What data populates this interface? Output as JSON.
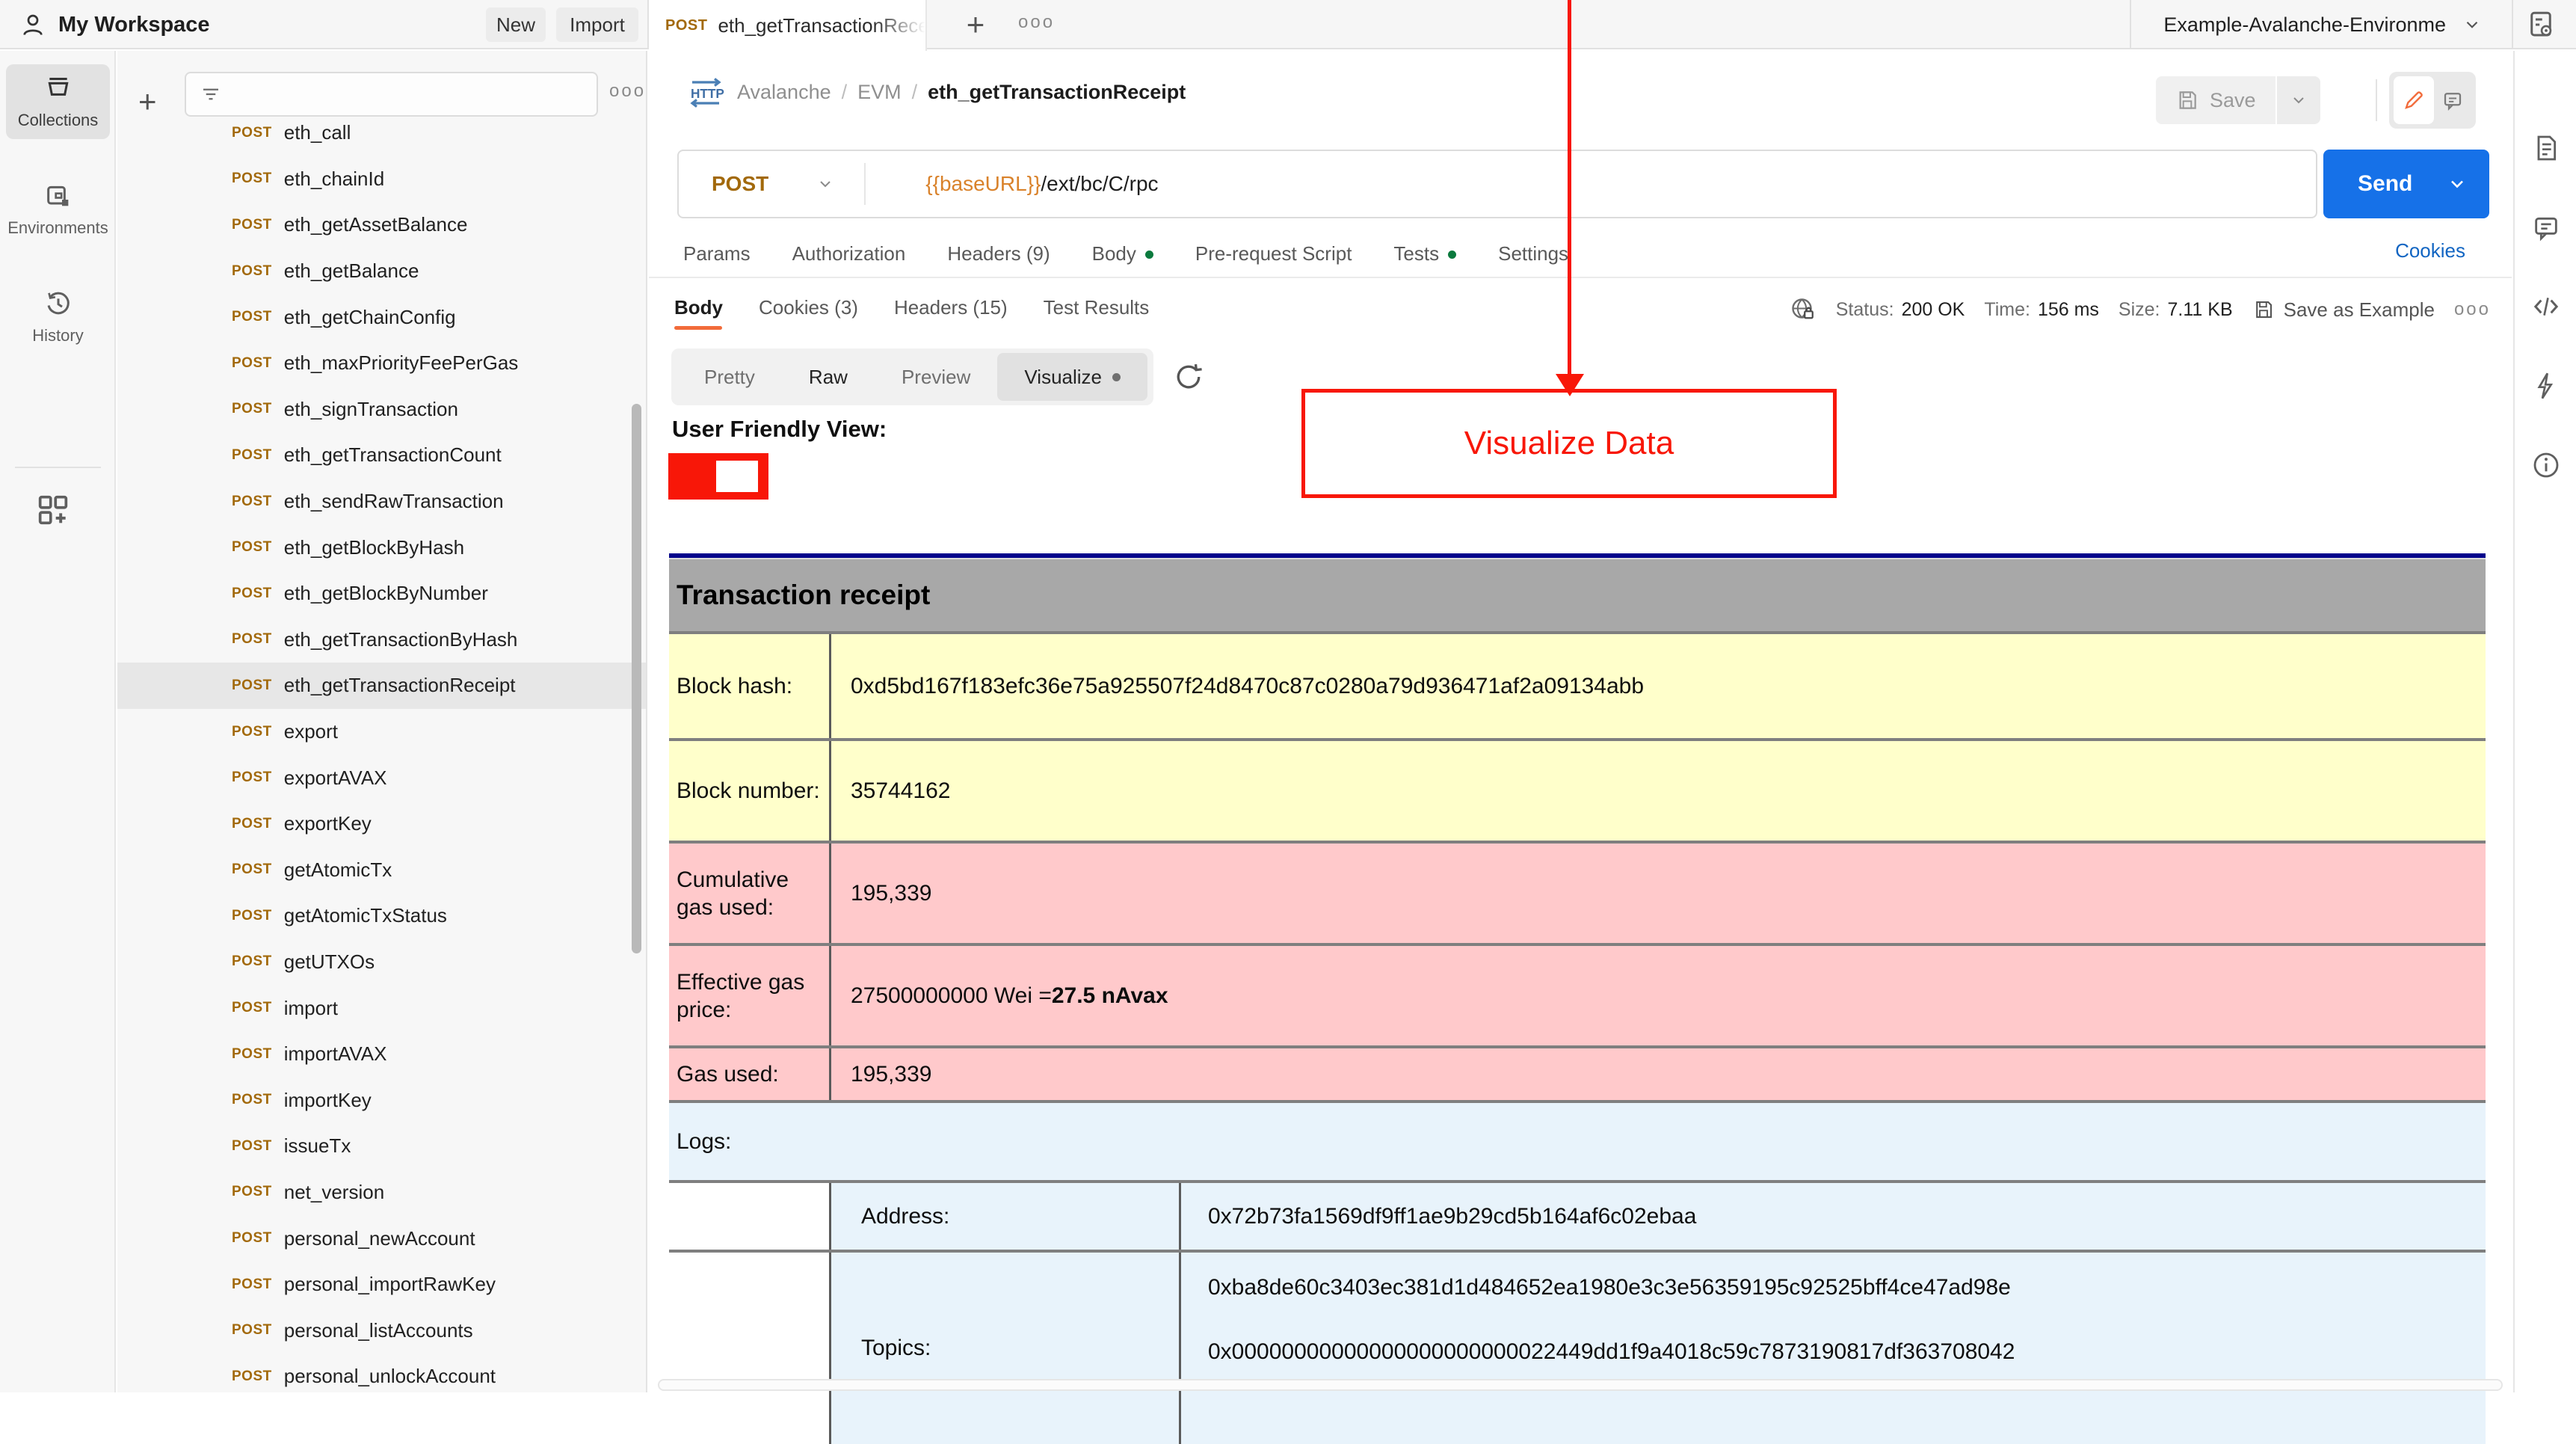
{
  "topbar": {
    "workspace": "My Workspace",
    "new_label": "New",
    "import_label": "Import",
    "tab": {
      "method": "POST",
      "label": "eth_getTransactionRece"
    },
    "environment": "Example-Avalanche-Environme"
  },
  "rail": {
    "items": [
      {
        "label": "Collections"
      },
      {
        "label": "Environments"
      },
      {
        "label": "History"
      }
    ]
  },
  "sidebar": {
    "items": [
      {
        "method": "POST",
        "name": "eth_call"
      },
      {
        "method": "POST",
        "name": "eth_chainId"
      },
      {
        "method": "POST",
        "name": "eth_getAssetBalance"
      },
      {
        "method": "POST",
        "name": "eth_getBalance"
      },
      {
        "method": "POST",
        "name": "eth_getChainConfig"
      },
      {
        "method": "POST",
        "name": "eth_maxPriorityFeePerGas"
      },
      {
        "method": "POST",
        "name": "eth_signTransaction"
      },
      {
        "method": "POST",
        "name": "eth_getTransactionCount"
      },
      {
        "method": "POST",
        "name": "eth_sendRawTransaction"
      },
      {
        "method": "POST",
        "name": "eth_getBlockByHash"
      },
      {
        "method": "POST",
        "name": "eth_getBlockByNumber"
      },
      {
        "method": "POST",
        "name": "eth_getTransactionByHash"
      },
      {
        "method": "POST",
        "name": "eth_getTransactionReceipt",
        "classes": [
          "selected"
        ]
      },
      {
        "method": "POST",
        "name": "export"
      },
      {
        "method": "POST",
        "name": "exportAVAX"
      },
      {
        "method": "POST",
        "name": "exportKey"
      },
      {
        "method": "POST",
        "name": "getAtomicTx"
      },
      {
        "method": "POST",
        "name": "getAtomicTxStatus"
      },
      {
        "method": "POST",
        "name": "getUTXOs"
      },
      {
        "method": "POST",
        "name": "import"
      },
      {
        "method": "POST",
        "name": "importAVAX"
      },
      {
        "method": "POST",
        "name": "importKey"
      },
      {
        "method": "POST",
        "name": "issueTx"
      },
      {
        "method": "POST",
        "name": "net_version"
      },
      {
        "method": "POST",
        "name": "personal_newAccount"
      },
      {
        "method": "POST",
        "name": "personal_importRawKey"
      },
      {
        "method": "POST",
        "name": "personal_listAccounts"
      },
      {
        "method": "POST",
        "name": "personal_unlockAccount"
      }
    ]
  },
  "request": {
    "breadcrumb": [
      "Avalanche",
      "EVM",
      "eth_getTransactionReceipt"
    ],
    "save_label": "Save",
    "method": "POST",
    "url_var": "{{baseURL}}",
    "url_path": "/ext/bc/C/rpc",
    "send_label": "Send",
    "tabs": [
      {
        "label": "Params"
      },
      {
        "label": "Authorization"
      },
      {
        "label": "Headers (9)"
      },
      {
        "label": "Body",
        "classes": [
          "dot"
        ]
      },
      {
        "label": "Pre-request Script"
      },
      {
        "label": "Tests",
        "classes": [
          "dot"
        ]
      },
      {
        "label": "Settings"
      }
    ],
    "cookies_link": "Cookies"
  },
  "response": {
    "tabs": [
      {
        "label": "Body",
        "classes": [
          "active"
        ]
      },
      {
        "label": "Cookies (3)"
      },
      {
        "label": "Headers (15)"
      },
      {
        "label": "Test Results"
      }
    ],
    "status_label": "Status:",
    "status_value": "200 OK",
    "time_label": "Time:",
    "time_value": "156 ms",
    "size_label": "Size:",
    "size_value": "7.11 KB",
    "save_example_label": "Save as Example",
    "views": [
      {
        "label": "Pretty"
      },
      {
        "label": "Raw",
        "classes": [
          "dark"
        ]
      },
      {
        "label": "Preview"
      },
      {
        "label": "Visualize",
        "classes": [
          "active",
          "gdot"
        ]
      }
    ]
  },
  "visualizer": {
    "heading": "User Friendly View:",
    "annotation": "Visualize Data",
    "table": {
      "title": "Transaction receipt",
      "rows": [
        {
          "label": "Block hash:",
          "value": "0xd5bd167f183efc36e75a925507f24d8470c87c0280a79d936471af2a09134abb",
          "value_bold": "",
          "classes": [
            "yellow",
            "h-hash"
          ]
        },
        {
          "label": "Block number:",
          "value": "35744162",
          "value_bold": "",
          "classes": [
            "yellow"
          ]
        },
        {
          "label": "Cumulative gas used:",
          "value": "195,339",
          "value_bold": "",
          "classes": [
            "pink"
          ]
        },
        {
          "label": "Effective gas price:",
          "value": "27500000000 Wei = ",
          "value_bold": "27.5 nAvax",
          "classes": [
            "pink"
          ]
        },
        {
          "label": "Gas used:",
          "value": "195,339",
          "value_bold": "",
          "classes": [
            "pink",
            "h-short"
          ]
        }
      ],
      "logs": {
        "title": "Logs:",
        "address_label": "Address:",
        "address": "0x72b73fa1569df9ff1ae9b29cd5b164af6c02ebaa",
        "topics_label": "Topics:",
        "topics": [
          "0xba8de60c3403ec381d1d484652ea1980e3c3e56359195c92525bff4ce47ad98e",
          "0x00000000000000000000000022449dd1f9a4018c59c7873190817df363708042"
        ]
      }
    }
  },
  "colors": {
    "annotation_red": "#f81708",
    "send_blue": "#1671e8",
    "method_post": "#a2690b",
    "accent_orange": "#f26b3a",
    "table_navy": "#00008b",
    "table_header_gray": "#a8a8a8",
    "row_yellow": "#ffffcb",
    "row_pink": "#ffc9cb",
    "row_blue": "#e8f3fb"
  }
}
